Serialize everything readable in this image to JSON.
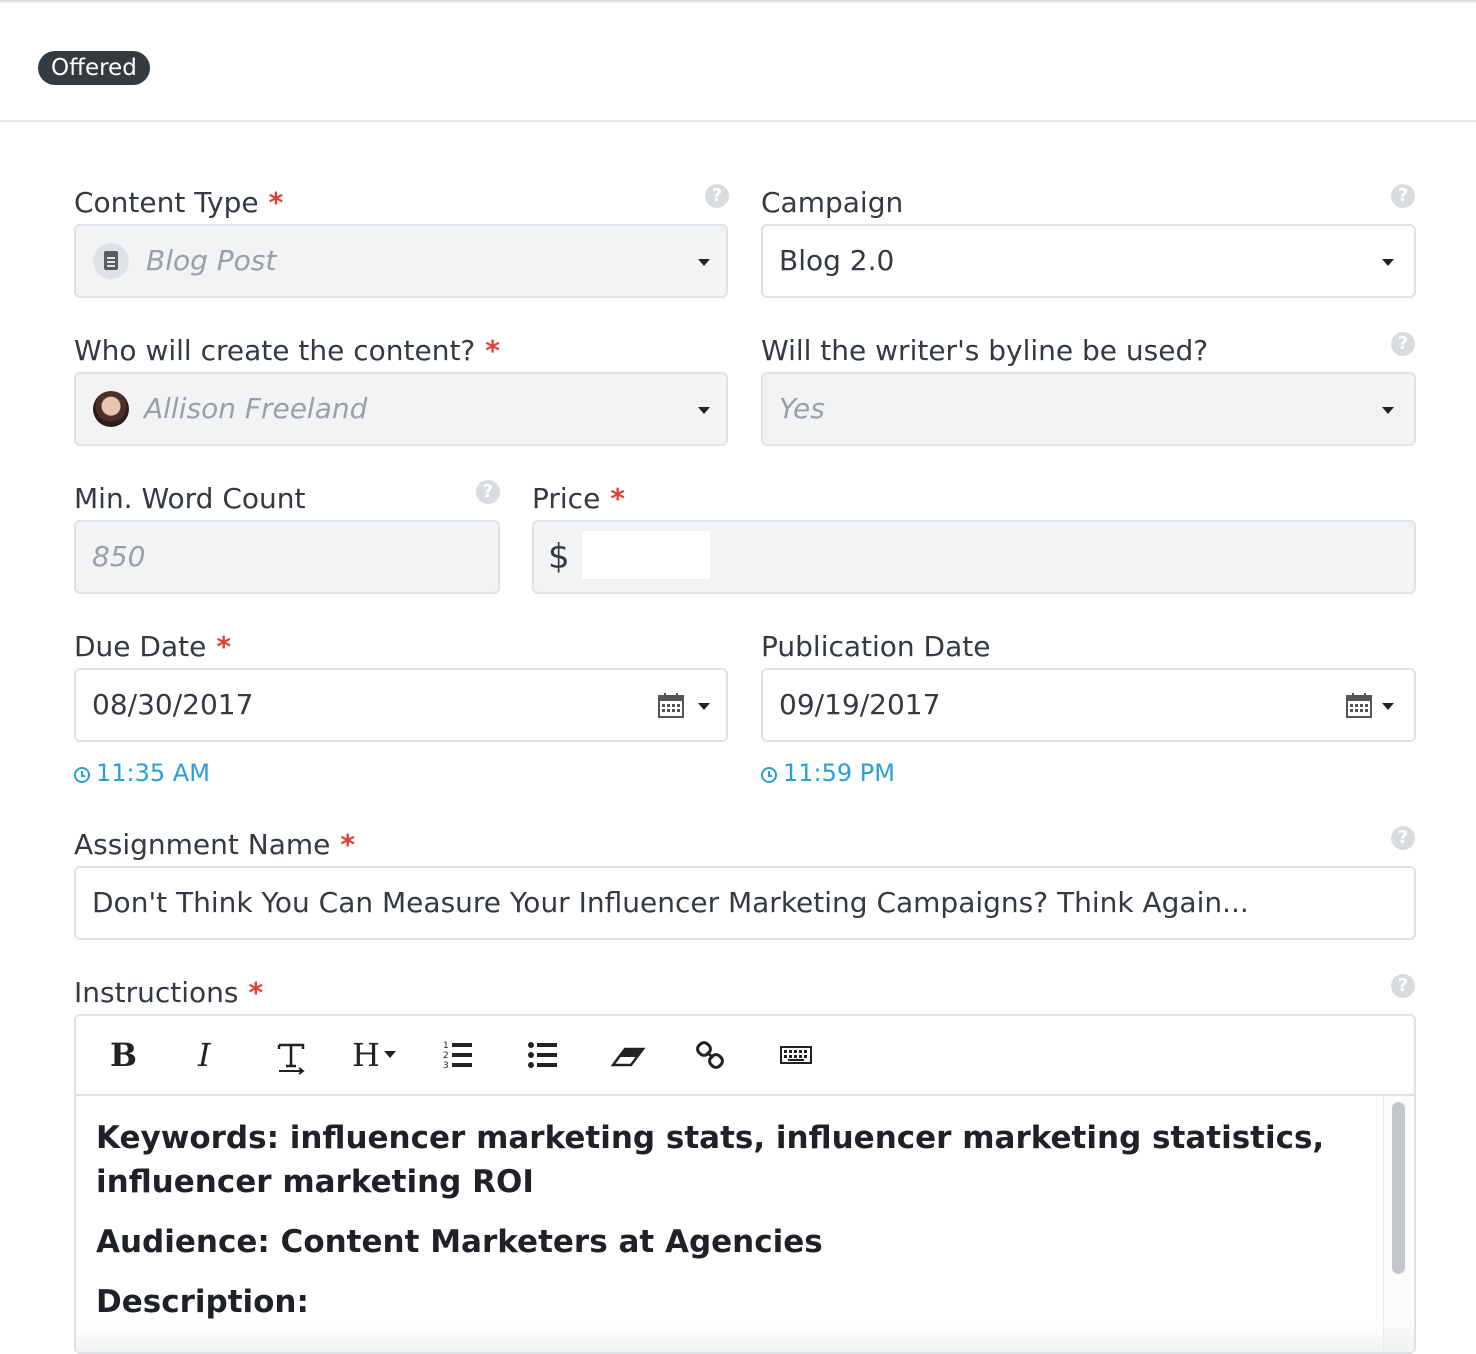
{
  "status_badge": "Offered",
  "form": {
    "content_type": {
      "label": "Content Type",
      "value": "Blog Post",
      "required": "*"
    },
    "campaign": {
      "label": "Campaign",
      "value": "Blog 2.0"
    },
    "creator": {
      "label": "Who will create the content?",
      "value": "Allison Freeland",
      "required": "*"
    },
    "byline": {
      "label": "Will the writer's byline be used?",
      "value": "Yes"
    },
    "word_count": {
      "label": "Min. Word Count",
      "placeholder": "850"
    },
    "price": {
      "label": "Price",
      "currency": "$",
      "value": "",
      "required": "*"
    },
    "due_date": {
      "label": "Due Date",
      "value": "08/30/2017",
      "time": "11:35 AM",
      "required": "*"
    },
    "publication_date": {
      "label": "Publication Date",
      "value": "09/19/2017",
      "time": "11:59 PM"
    },
    "assignment_name": {
      "label": "Assignment Name",
      "value": "Don't Think You Can Measure Your Influencer Marketing Campaigns? Think Again...",
      "required": "*"
    },
    "instructions": {
      "label": "Instructions",
      "required": "*",
      "toolbar": {
        "bold": "B",
        "italic": "I",
        "heading": "H"
      },
      "content": {
        "keywords": "Keywords: influencer marketing stats, influencer marketing statistics, influencer marketing ROI",
        "audience": "Audience: Content Marketers at Agencies",
        "description": "Description:"
      }
    }
  },
  "help_icon": "?",
  "icons": [
    "help-icon",
    "document-icon",
    "calendar-icon",
    "clock-icon",
    "link-icon",
    "keyboard-icon",
    "eraser-icon"
  ]
}
